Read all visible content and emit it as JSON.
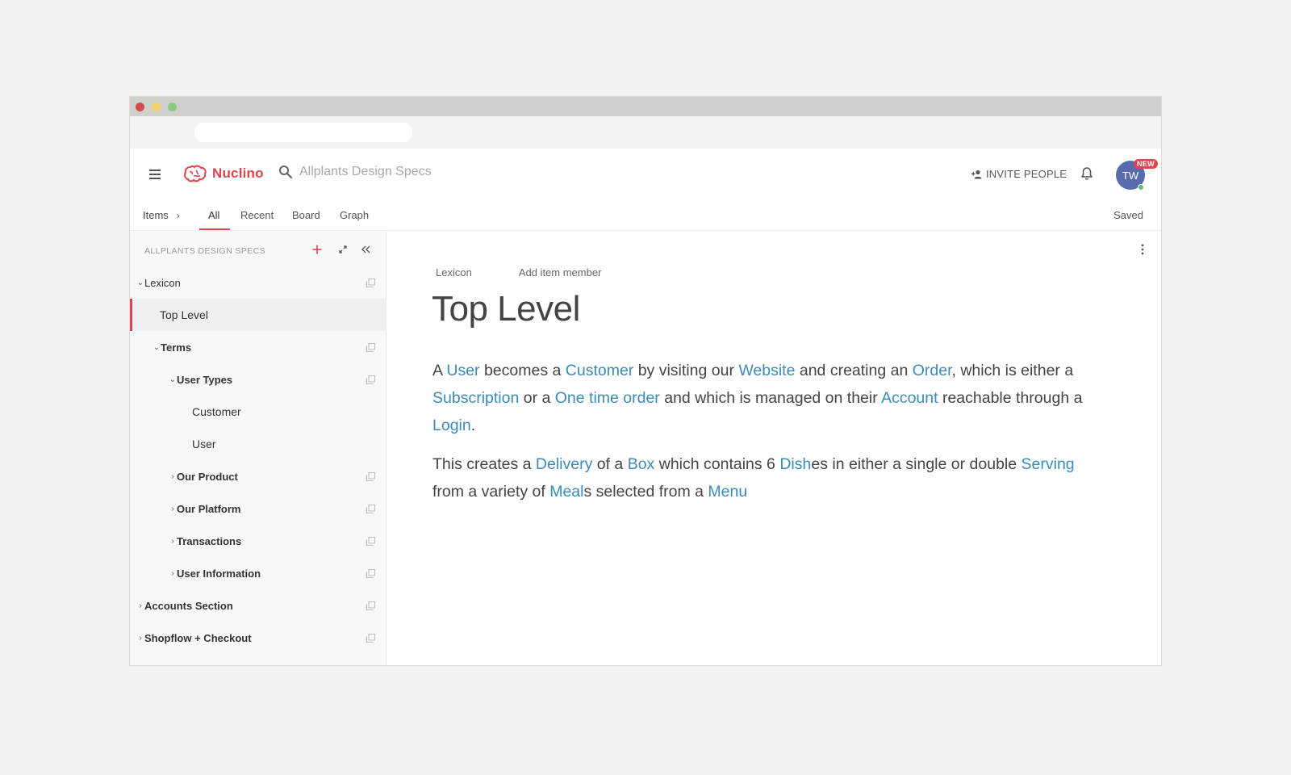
{
  "app": {
    "name": "Nuclino",
    "search_placeholder": "Allplants Design Specs",
    "invite_label": "INVITE PEOPLE",
    "avatar_initials": "TW",
    "new_badge": "NEW",
    "brand_color": "#e0444f",
    "link_color": "#3c8ab8"
  },
  "tabs": {
    "items_label": "Items",
    "list": [
      "All",
      "Recent",
      "Board",
      "Graph"
    ],
    "active": "All",
    "status": "Saved"
  },
  "sidebar": {
    "workspace_title": "ALLPLANTS DESIGN SPECS",
    "tree": [
      {
        "label": "Lexicon",
        "expanded": true,
        "level": 0
      },
      {
        "label": "Top Level",
        "selected": true,
        "level": 1
      },
      {
        "label": "Terms",
        "expanded": true,
        "level": 1
      },
      {
        "label": "User Types",
        "expanded": true,
        "level": 2
      },
      {
        "label": "Customer",
        "level": 3
      },
      {
        "label": "User",
        "level": 3
      },
      {
        "label": "Our Product",
        "expanded": false,
        "level": 2
      },
      {
        "label": "Our Platform",
        "expanded": false,
        "level": 2
      },
      {
        "label": "Transactions",
        "expanded": false,
        "level": 2
      },
      {
        "label": "User Information",
        "expanded": false,
        "level": 2
      },
      {
        "label": "Accounts Section",
        "expanded": false,
        "level": 0
      },
      {
        "label": "Shopflow + Checkout",
        "expanded": false,
        "level": 0
      }
    ]
  },
  "document": {
    "breadcrumb": "Lexicon",
    "add_member": "Add item member",
    "title": "Top Level",
    "p1": [
      "A ",
      {
        "link": "User"
      },
      " becomes a ",
      {
        "link": "Customer"
      },
      " by visiting our ",
      {
        "link": "Website"
      },
      " and creating an ",
      {
        "link": "Order"
      },
      ", which is either a ",
      {
        "link": "Subscription"
      },
      " or a ",
      {
        "link": "One time order"
      },
      " and which is managed on their ",
      {
        "link": "Account"
      },
      " reachable through a ",
      {
        "link": "Login"
      },
      "."
    ],
    "p2": [
      "This creates a ",
      {
        "link": "Delivery"
      },
      " of a ",
      {
        "link": "Box"
      },
      " which contains 6 ",
      {
        "link": "Dish"
      },
      "es in either a single or double ",
      {
        "link": "Serving"
      },
      " from a variety of ",
      {
        "link": "Meal"
      },
      "s selected from a ",
      {
        "link": "Menu"
      }
    ]
  }
}
